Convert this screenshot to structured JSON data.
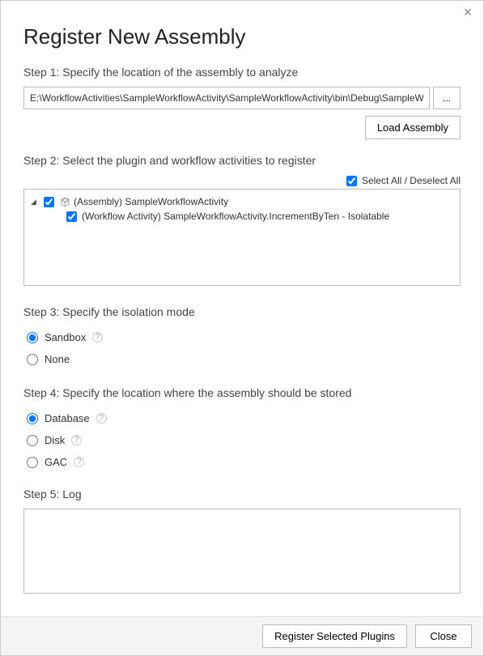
{
  "window": {
    "title": "Register New Assembly"
  },
  "step1": {
    "label": "Step 1: Specify the location of the assembly to analyze",
    "path": "E:\\WorkflowActivities\\SampleWorkflowActivity\\SampleWorkflowActivity\\bin\\Debug\\SampleWo",
    "browse": "...",
    "load_btn": "Load Assembly"
  },
  "step2": {
    "label": "Step 2: Select the plugin and workflow activities to register",
    "select_all_label": "Select All / Deselect All",
    "select_all_checked": true,
    "tree": {
      "assembly": {
        "checked": true,
        "label": "(Assembly) SampleWorkflowActivity"
      },
      "activity": {
        "checked": true,
        "label": "(Workflow Activity) SampleWorkflowActivity.IncrementByTen - Isolatable"
      }
    }
  },
  "step3": {
    "label": "Step 3: Specify the isolation mode",
    "options": {
      "sandbox": "Sandbox",
      "none": "None"
    },
    "selected": "sandbox"
  },
  "step4": {
    "label": "Step 4: Specify the location where the assembly should be stored",
    "options": {
      "database": "Database",
      "disk": "Disk",
      "gac": "GAC"
    },
    "selected": "database"
  },
  "step5": {
    "label": "Step 5: Log"
  },
  "footer": {
    "register": "Register Selected Plugins",
    "close": "Close"
  }
}
